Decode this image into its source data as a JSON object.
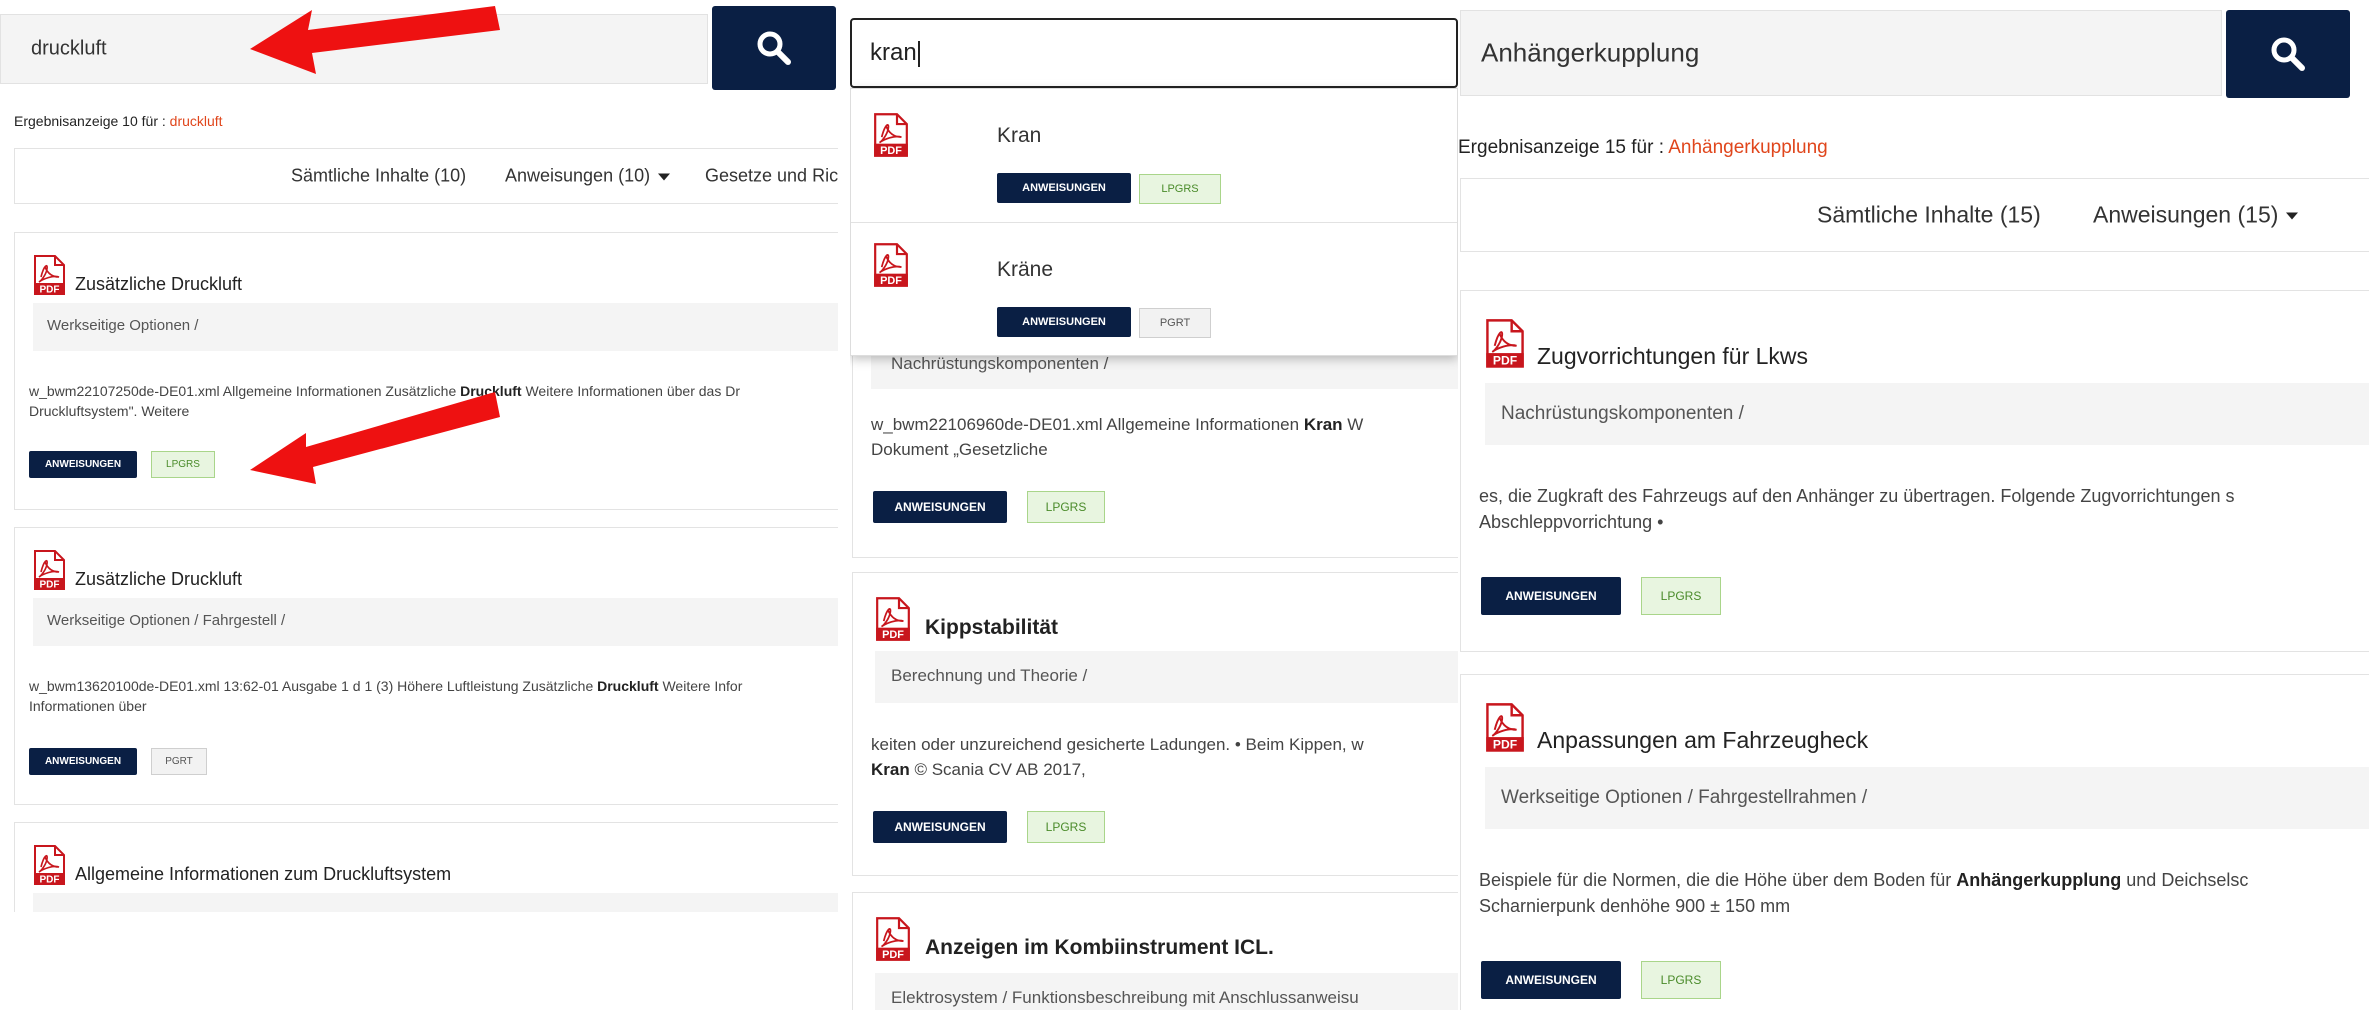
{
  "panel1": {
    "search": {
      "value": "druckluft"
    },
    "result_prefix": "Ergebnisanzeige 10 für :",
    "result_term": "druckluft",
    "filters": [
      "Sämtliche Inhalte (10)",
      "Anweisungen (10)",
      "Gesetze und Ric"
    ],
    "cards": [
      {
        "title": "Zusätzliche Druckluft",
        "path": "Werkseitige Optionen /",
        "snippet_pre": "w_bwm22107250de-DE01.xml Allgemeine Informationen Zusätzliche ",
        "snippet_bold": "Druckluft",
        "snippet_post": " Weitere Informationen über das Dr",
        "snippet_line2": "Druckluftsystem\". Weitere",
        "tag_primary": "ANWEISUNGEN",
        "tag_secondary": "LPGRS"
      },
      {
        "title": "Zusätzliche Druckluft",
        "path": "Werkseitige Optionen / Fahrgestell /",
        "snippet_pre": "w_bwm13620100de-DE01.xml 13:62-01 Ausgabe 1 d 1 (3) Höhere Luftleistung Zusätzliche ",
        "snippet_bold": "Druckluft",
        "snippet_post": " Weitere Infor",
        "snippet_line2": "Informationen über",
        "tag_primary": "ANWEISUNGEN",
        "tag_secondary": "PGRT"
      },
      {
        "title": "Allgemeine Informationen zum Druckluftsystem"
      }
    ]
  },
  "panel2": {
    "search": {
      "value": "kran"
    },
    "suggestions": [
      {
        "name": "Kran",
        "tag_primary": "ANWEISUNGEN",
        "tag_secondary": "LPGRS"
      },
      {
        "name": "Kräne",
        "tag_primary": "ANWEISUNGEN",
        "tag_secondary": "PGRT"
      }
    ],
    "card0": {
      "path": "Nachrüstungskomponenten /",
      "snippet_pre": "w_bwm22106960de-DE01.xml Allgemeine Informationen ",
      "snippet_bold": "Kran",
      "snippet_post": " W",
      "snippet_line2": "Dokument „Gesetzliche",
      "tag_primary": "ANWEISUNGEN",
      "tag_secondary": "LPGRS"
    },
    "cards": [
      {
        "title": "Kippstabilität",
        "path": "Berechnung und Theorie /",
        "snippet_line1": "keiten oder unzureichend gesicherte Ladungen. • Beim Kippen, w",
        "snippet_bold": "Kran",
        "snippet_line2_rest": " © Scania CV AB 2017,",
        "tag_primary": "ANWEISUNGEN",
        "tag_secondary": "LPGRS"
      },
      {
        "title": "Anzeigen im Kombiinstrument ICL.",
        "path": "Elektrosystem / Funktionsbeschreibung mit Anschlussanweisu"
      }
    ]
  },
  "panel3": {
    "search": {
      "value": "Anhängerkupplung"
    },
    "result_prefix": "Ergebnisanzeige 15 für :",
    "result_term": "Anhängerkupplung",
    "filters": [
      "Sämtliche Inhalte (15)",
      "Anweisungen (15)"
    ],
    "cards": [
      {
        "title": "Zugvorrichtungen für Lkws",
        "path": "Nachrüstungskomponenten /",
        "snippet_line1": "es, die Zugkraft des Fahrzeugs auf den Anhänger zu übertragen. Folgende Zugvorrichtungen s",
        "snippet_line2": "Abschleppvorrichtung •",
        "tag_primary": "ANWEISUNGEN",
        "tag_secondary": "LPGRS"
      },
      {
        "title": "Anpassungen am Fahrzeugheck",
        "path": "Werkseitige Optionen / Fahrgestellrahmen /",
        "snippet_pre": "Beispiele für die Normen, die die Höhe über dem Boden für ",
        "snippet_bold": "Anhängerkupplung",
        "snippet_post": " und Deichselsc",
        "snippet_line2": "Scharnierpunk denhöhe 900 ± 150 mm",
        "tag_primary": "ANWEISUNGEN",
        "tag_secondary": "LPGRS"
      }
    ]
  },
  "colors": {
    "navy": "#0a1f44",
    "accent": "#e0461c",
    "arrow": "#ee1111",
    "pdf_red": "#c8161d"
  },
  "icons": {
    "search": "search-icon",
    "pdf": "pdf-icon",
    "caret": "caret-down-icon",
    "arrow": "red-arrow-annotation"
  }
}
